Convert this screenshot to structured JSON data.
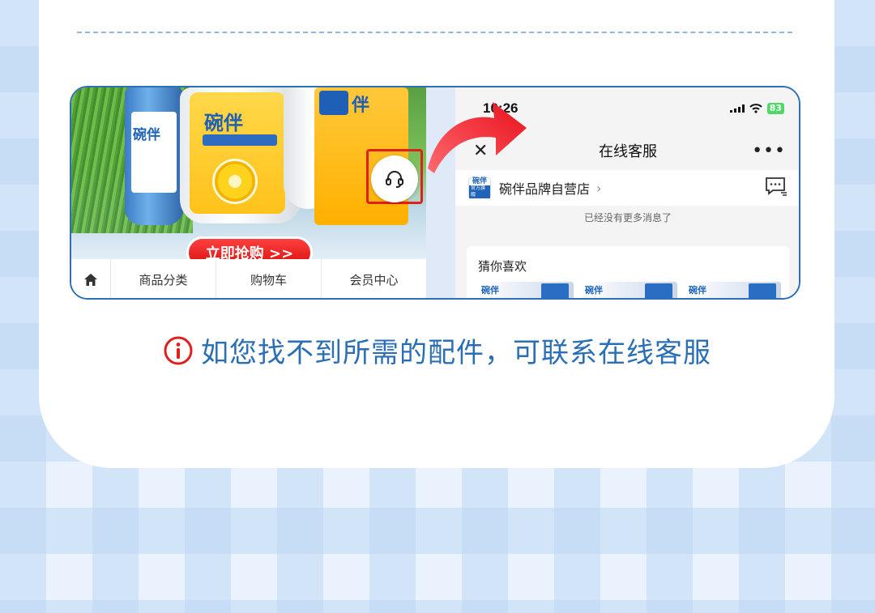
{
  "store": {
    "banner": {
      "product_brand": "碗伴",
      "buy_button": "立即抢购 >>"
    },
    "nav": {
      "items": [
        "商品分类",
        "购物车",
        "会员中心"
      ]
    }
  },
  "phone": {
    "time": "10:26",
    "battery": "83",
    "title": "在线客服",
    "shop": {
      "logo_text": "碗伴",
      "logo_sub": "官方旗舰",
      "name": "碗伴品牌自营店"
    },
    "no_more_messages": "已经没有更多消息了",
    "guess_you_like": "猜你喜欢",
    "thumb_brand": "碗伴"
  },
  "hint": {
    "text": "如您找不到所需的配件，可联系在线客服"
  },
  "colors": {
    "frame_border": "#2f6fb4",
    "hint_text": "#2a6fb6",
    "alert_red": "#e0201c",
    "arrow_red": "#e8202a"
  }
}
